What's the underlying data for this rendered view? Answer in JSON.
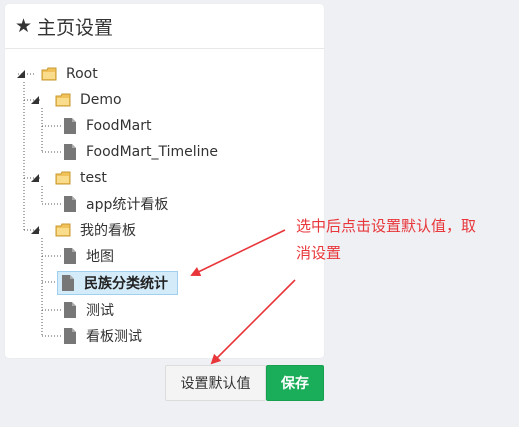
{
  "panel": {
    "title": "主页设置"
  },
  "tree": {
    "root": "Root",
    "nodes": {
      "demo": "Demo",
      "foodmart": "FoodMart",
      "foodmart_timeline": "FoodMart_Timeline",
      "test": "test",
      "app_board": "app统计看板",
      "my_boards": "我的看板",
      "map": "地图",
      "ethnic_stats": "民族分类统计",
      "ceshi": "测试",
      "board_test": "看板测试"
    },
    "selected": "ethnic_stats"
  },
  "buttons": {
    "set_default": "设置默认值",
    "save": "保存"
  },
  "annotation": {
    "line1": "选中后点击设置默认值，取",
    "line2": "消设置"
  },
  "colors": {
    "save_green": "#1aad5a",
    "annotation_red": "#e8363a",
    "selected_bg": "#d4ecfa"
  }
}
